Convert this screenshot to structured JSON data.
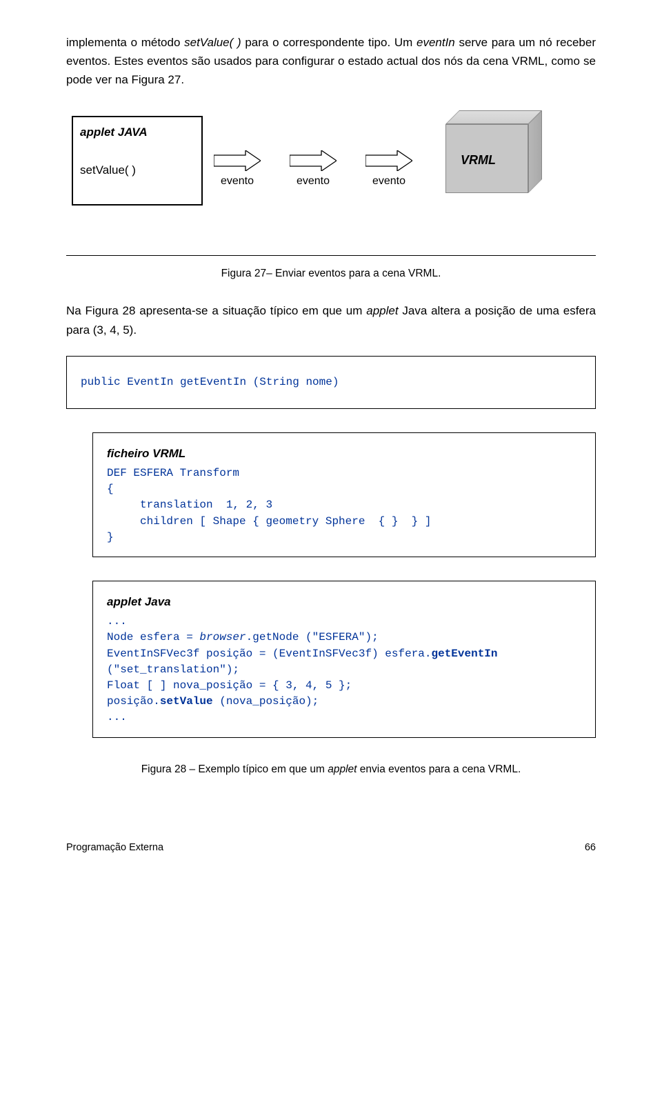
{
  "intro": {
    "seg1": "implementa o método ",
    "method": "setValue( )",
    "seg2": " para o correspondente tipo. Um ",
    "eventin": "eventIn",
    "seg3": " serve para um nó receber eventos. Estes eventos são usados para configurar o estado actual dos nós da cena VRML, como se pode ver na Figura 27."
  },
  "fig27": {
    "applet_title": "applet JAVA",
    "setValue": "setValue( )",
    "arrow_label": "evento",
    "vrml_label": "VRML",
    "caption": "Figura 27– Enviar eventos para a cena VRML."
  },
  "para2": {
    "seg1": "Na Figura 28 apresenta-se a situação típico em que um ",
    "applet": "applet",
    "seg2": " Java altera a posição de uma esfera para (3, 4, 5)."
  },
  "fig28": {
    "box1_line": "public EventIn getEventIn (String nome)",
    "box2_title": "ficheiro VRML",
    "box2_code": "DEF ESFERA Transform\n{\n     translation  1, 2, 3\n     children [ Shape { geometry Sphere  { }  } ]\n}",
    "box3_title": "applet Java",
    "box3_l1": "...",
    "box3_l2a": "Node esfera = ",
    "box3_l2b": "browser",
    "box3_l2c": ".getNode (\"ESFERA\");",
    "box3_l3a": "EventInSFVec3f posição = (EventInSFVec3f) esfera.",
    "box3_l3b": "getEventIn",
    "box3_l4": "(\"set_translation\");",
    "box3_l5": "Float [ ] nova_posição = { 3, 4, 5 };",
    "box3_l6a": "posição.",
    "box3_l6b": "setValue",
    "box3_l6c": " (nova_posição);",
    "box3_l7": "...",
    "caption_a": "Figura 28 – Exemplo típico em que um ",
    "caption_b": "applet",
    "caption_c": " envia eventos para a cena VRML."
  },
  "footer": {
    "left": "Programação Externa",
    "right": "66"
  }
}
